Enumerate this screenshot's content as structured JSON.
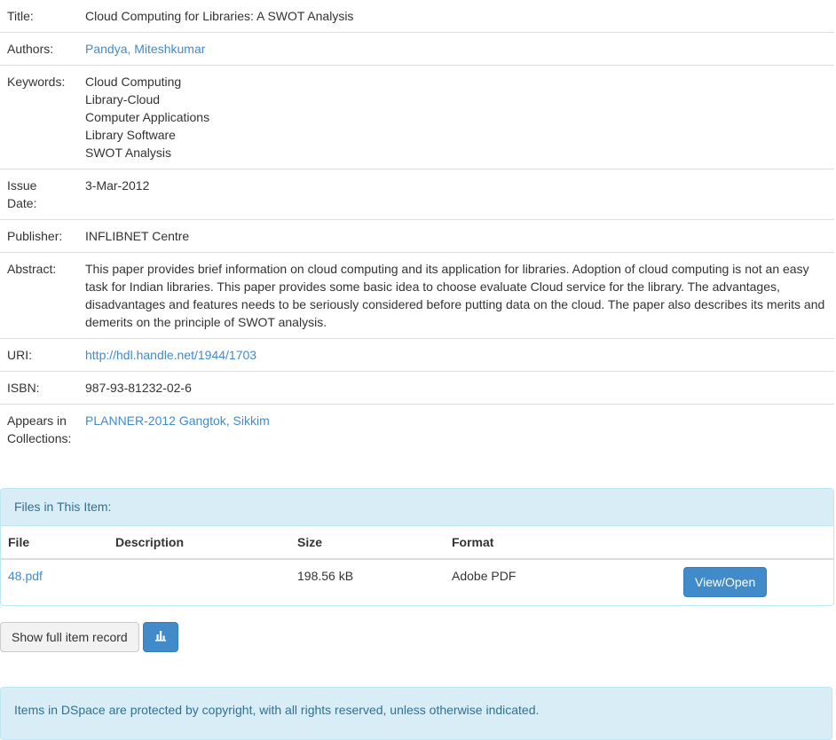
{
  "metadata": {
    "title": {
      "label": "Title:",
      "value": "Cloud Computing for Libraries: A SWOT Analysis"
    },
    "authors": {
      "label": "Authors:",
      "value": "Pandya, Miteshkumar"
    },
    "keywords": {
      "label": "Keywords:",
      "items": [
        "Cloud Computing",
        "Library-Cloud",
        "Computer Applications",
        "Library Software",
        "SWOT Analysis"
      ]
    },
    "issue_date": {
      "label_line1": "Issue",
      "label_line2": "Date:",
      "value": "3-Mar-2012"
    },
    "publisher": {
      "label": "Publisher:",
      "value": "INFLIBNET Centre"
    },
    "abstract": {
      "label": "Abstract:",
      "value": "This paper provides brief information on cloud computing and its application for libraries. Adoption of cloud computing is not an easy task for Indian libraries. This paper provides some basic idea to choose evaluate Cloud service for the library. The advantages, disadvantages and features needs to be seriously considered before putting data on the cloud. The paper also describes its merits and demerits on the principle of SWOT analysis."
    },
    "uri": {
      "label": "URI:",
      "value": "http://hdl.handle.net/1944/1703"
    },
    "isbn": {
      "label": "ISBN:",
      "value": "987-93-81232-02-6"
    },
    "collections": {
      "label_line1": "Appears in",
      "label_line2": "Collections:",
      "value": "PLANNER-2012 Gangtok, Sikkim"
    }
  },
  "files_panel": {
    "heading": "Files in This Item:",
    "columns": [
      "File",
      "Description",
      "Size",
      "Format"
    ],
    "rows": [
      {
        "file": "48.pdf",
        "description": "",
        "size": "198.56 kB",
        "format": "Adobe PDF",
        "action": "View/Open"
      }
    ]
  },
  "actions": {
    "full_record_label": "Show full item record",
    "stats_icon": "bar-chart-icon"
  },
  "license": {
    "text": "Items in DSpace are protected by copyright, with all rights reserved, unless otherwise indicated."
  },
  "colors": {
    "link": "#428bca",
    "primary_button": "#428bca",
    "panel_heading_bg": "#d9edf7",
    "panel_heading_text": "#31708f"
  }
}
